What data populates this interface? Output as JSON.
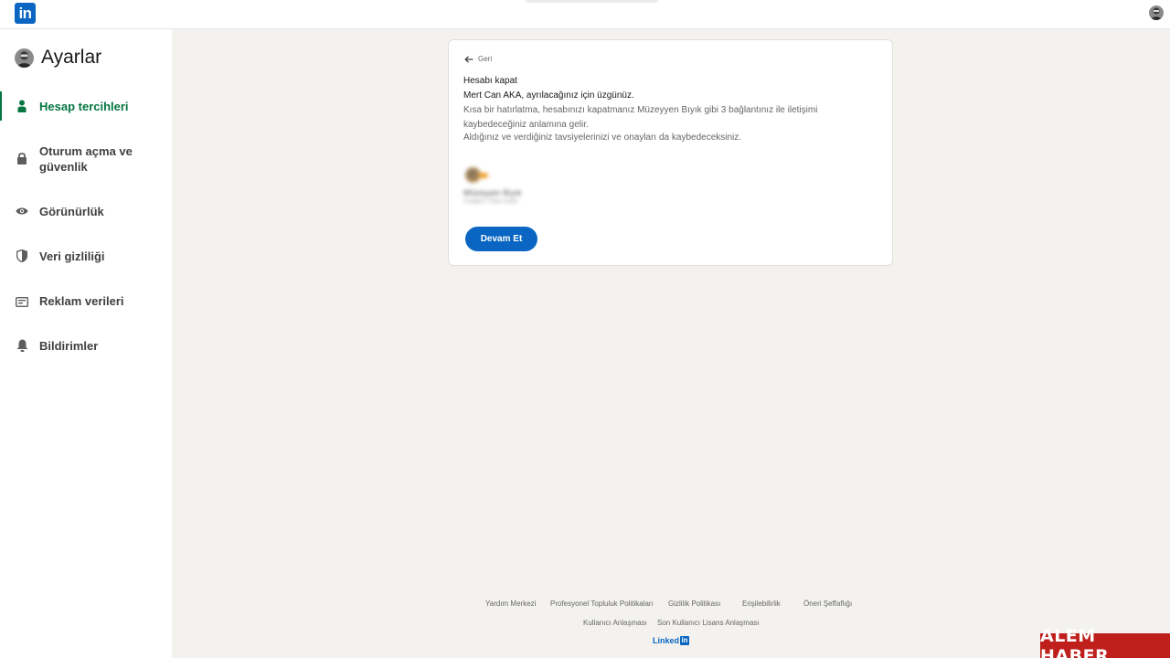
{
  "topbar": {
    "logo_text": "in"
  },
  "sidebar": {
    "title": "Ayarlar",
    "items": [
      {
        "label": "Hesap tercihleri",
        "icon": "person-icon",
        "active": true
      },
      {
        "label": "Oturum açma ve güvenlik",
        "icon": "lock-icon",
        "active": false
      },
      {
        "label": "Görünürlük",
        "icon": "eye-icon",
        "active": false
      },
      {
        "label": "Veri gizliliği",
        "icon": "shield-icon",
        "active": false
      },
      {
        "label": "Reklam verileri",
        "icon": "ad-card-icon",
        "active": false
      },
      {
        "label": "Bildirimler",
        "icon": "bell-icon",
        "active": false
      }
    ]
  },
  "card": {
    "back_label": "Geri",
    "title": "Hesabı kapat",
    "sorry_text": "Mert Can AKA, ayrılacağınız için üzgünüz.",
    "reminder_text": "Kısa bir hatırlatma, hesabınızı kapatmanız Müzeyyen Bıyık gibi 3 bağlantınız ile iletişimi kaybedeceğiniz anlamına gelir.",
    "recommendations_text": "Aldığınız ve verdiğiniz tavsiyelerinizi ve onayları da kaybedeceksiniz.",
    "connection": {
      "name": "Müzeyyen Bıyık",
      "subtitle": "Fotoğraf / Video Editör"
    },
    "continue_label": "Devam Et"
  },
  "footer": {
    "row1": [
      "Yardım Merkezi",
      "Profesyonel Topluluk Politikaları",
      "Gizlilik Politikası",
      "Erişilebilirlik",
      "Öneri Şeffaflığı"
    ],
    "row2": [
      "Kullanıcı Anlaşması",
      "Son Kullanıcı Lisans Anlaşması"
    ],
    "brand": "Linked",
    "brand_in": "in"
  },
  "watermark": "ALEM HABER",
  "colors": {
    "brand_blue": "#0a66c2",
    "active_green": "#057642",
    "background": "#f3f2ef",
    "watermark_red": "#c0201c"
  }
}
